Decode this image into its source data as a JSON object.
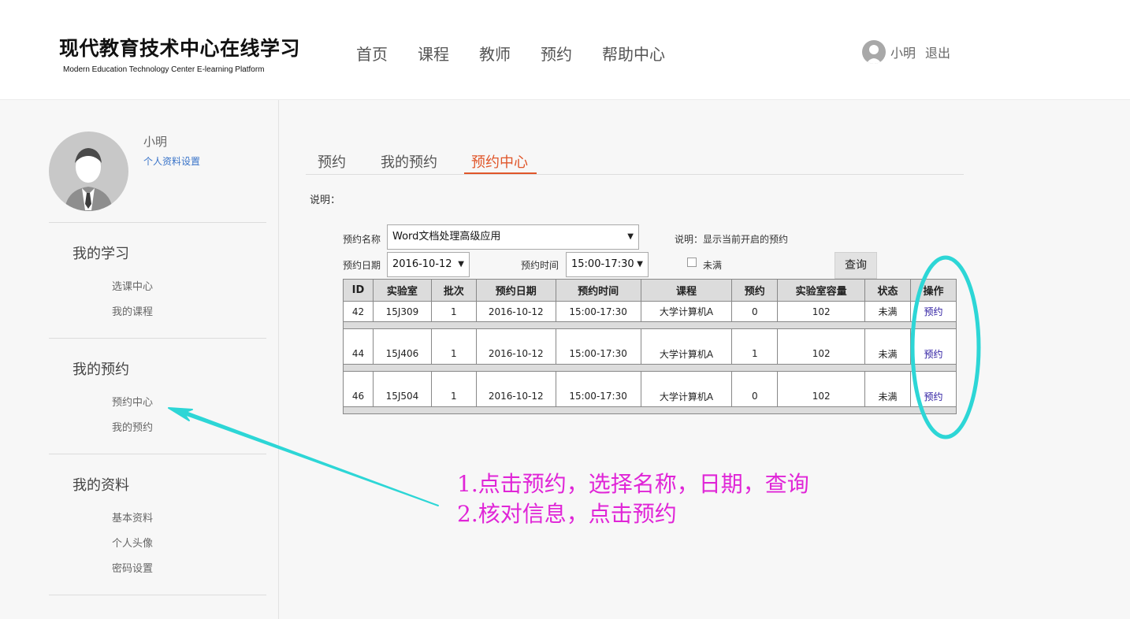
{
  "header": {
    "title": "现代教育技术中心在线学习",
    "subtitle": "Modern Education Technology Center E-learning Platform",
    "nav": [
      "首页",
      "课程",
      "教师",
      "预约",
      "帮助中心"
    ],
    "user_name": "小明",
    "logout": "退出"
  },
  "sidebar": {
    "name": "小明",
    "profile_link": "个人资料设置",
    "groups": [
      {
        "title": "我的学习",
        "items": [
          "选课中心",
          "我的课程"
        ]
      },
      {
        "title": "我的预约",
        "items": [
          "预约中心",
          "我的预约"
        ]
      },
      {
        "title": "我的资料",
        "items": [
          "基本资料",
          "个人头像",
          "密码设置"
        ]
      }
    ]
  },
  "tabs": [
    "预约",
    "我的预约",
    "预约中心"
  ],
  "active_tab": "预约中心",
  "note_label": "说明：",
  "form": {
    "name_label": "预约名称",
    "name_value": "Word文档处理高级应用",
    "desc": "说明：显示当前开启的预约",
    "date_label": "预约日期",
    "date_value": "2016-10-12",
    "time_label": "预约时间",
    "time_value": "15:00-17:30",
    "checkbox_label": "未满",
    "checkbox_checked": false,
    "query_button": "查询"
  },
  "table": {
    "headers": [
      "ID",
      "实验室",
      "批次",
      "预约日期",
      "预约时间",
      "课程",
      "预约",
      "实验室容量",
      "状态",
      "操作"
    ],
    "rows": [
      [
        "42",
        "15J309",
        "1",
        "2016-10-12",
        "15:00-17:30",
        "大学计算机A",
        "0",
        "102",
        "未满",
        "预约"
      ],
      [
        "44",
        "15J406",
        "1",
        "2016-10-12",
        "15:00-17:30",
        "大学计算机A",
        "1",
        "102",
        "未满",
        "预约"
      ],
      [
        "46",
        "15J504",
        "1",
        "2016-10-12",
        "15:00-17:30",
        "大学计算机A",
        "0",
        "102",
        "未满",
        "预约"
      ]
    ]
  },
  "annotations": {
    "line1": "1.点击预约，选择名称，日期，查询",
    "line2": "2.核对信息，点击预约",
    "text_color": "#e025d7",
    "highlight_color": "#2dd6d6"
  }
}
